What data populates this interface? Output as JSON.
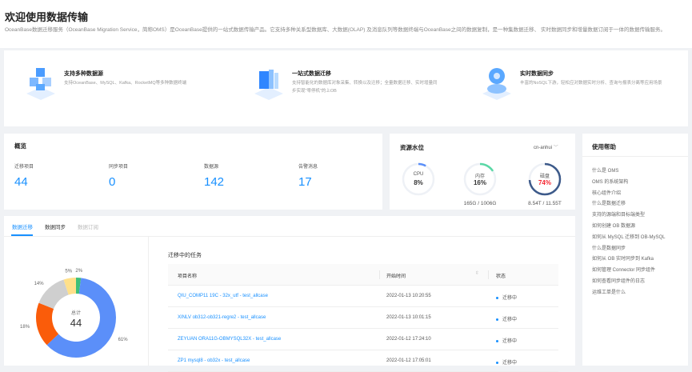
{
  "header": {
    "title": "欢迎使用数据传输",
    "description": "OceanBase数据迁移服务（OceanBase Migration Service，简称OMS）是OceanBase提供的一站式数据传输产品。它支持多种关系型数据库、大数据(OLAP) 及消息队列等数据终端与OceanBase之间的数据复制，是一种集数据迁移、 实时数据同步和增量数据订阅于一体的数据传输服务。"
  },
  "features": [
    {
      "title": "支持多种数据源",
      "desc": "支持OceanBase、MySQL、Kafka、RocketMQ等多种数据终端",
      "icon": "cubes-icon"
    },
    {
      "title": "一站式数据迁移",
      "desc": "支持智能化的数据库对象采集、转换以及迁移；全量数据迁移、实时增量同步实现\"零停机\"的上OB",
      "icon": "migration-icon"
    },
    {
      "title": "实时数据同步",
      "desc": "丰富的NoSQL下游，轻松应对数据实时分析、查询与报表分离等应用场景",
      "icon": "sync-icon"
    }
  ],
  "overview": {
    "title": "概览",
    "stats": [
      {
        "label": "迁移项目",
        "value": "44"
      },
      {
        "label": "同步项目",
        "value": "0"
      },
      {
        "label": "数据源",
        "value": "142"
      },
      {
        "label": "告警消息",
        "value": "17"
      }
    ]
  },
  "resources": {
    "title": "资源水位",
    "region": "cn-anhui",
    "gauges": [
      {
        "label": "CPU",
        "value": "8%",
        "percent": 8,
        "color": "#5b8ff9",
        "text_color": "#333",
        "detail": ""
      },
      {
        "label": "内存",
        "value": "16%",
        "percent": 16,
        "color": "#5ad8a6",
        "text_color": "#333",
        "detail": "165G / 1006G"
      },
      {
        "label": "磁盘",
        "value": "74%",
        "percent": 74,
        "color": "#3d5a8a",
        "text_color": "#f5222d",
        "detail": "8.54T / 11.55T"
      }
    ]
  },
  "help": {
    "title": "使用帮助",
    "items": [
      "什么是 OMS",
      "OMS 的系统架构",
      "核心组件介绍",
      "什么是数据迁移",
      "支持的源端和目标端类型",
      "如何创建 OB 数据源",
      "如何从 MySQL 迁移到 OB-MySQL",
      "什么是数据同步",
      "如何从 OB 实时同步到 Kafka",
      "如何管理 Connector 同步组件",
      "如何查看同步组件的日志",
      "运维工单是什么"
    ]
  },
  "tabs": [
    {
      "label": "数据迁移",
      "state": "active"
    },
    {
      "label": "数据同步",
      "state": "normal"
    },
    {
      "label": "数据订阅",
      "state": "disabled"
    }
  ],
  "chart_data": {
    "type": "pie",
    "donut": true,
    "center_label": "总计",
    "center_value": "44",
    "slices": [
      {
        "value": 2,
        "label": "2%",
        "color": "#3ebf7a"
      },
      {
        "value": 61,
        "label": "61%",
        "color": "#5b8ff9"
      },
      {
        "value": 18,
        "label": "18%",
        "color": "#fa5c0a"
      },
      {
        "value": 14,
        "label": "14%",
        "color": "#cfcfcf"
      },
      {
        "value": 5,
        "label": "5%",
        "color": "#ffe08a"
      }
    ]
  },
  "tasks": {
    "title": "迁移中的任务",
    "columns": [
      "项目名称",
      "开始时间",
      "状态"
    ],
    "rows": [
      {
        "name": "QIU_COMP11 19C - 32x_utf - test_allcase",
        "time": "2022-01-13 10:20:55",
        "status": "迁移中"
      },
      {
        "name": "XINLV ob312-ob321-regre2 - test_allcase",
        "time": "2022-01-13 10:01:15",
        "status": "迁移中"
      },
      {
        "name": "ZEYUAN ORA11G-OBMYSQL32X - test_allcase",
        "time": "2022-01-12 17:24:10",
        "status": "迁移中"
      },
      {
        "name": "ZP1 mysql8 - ob32x - test_allcase",
        "time": "2022-01-12 17:05:01",
        "status": "迁移中"
      }
    ]
  }
}
